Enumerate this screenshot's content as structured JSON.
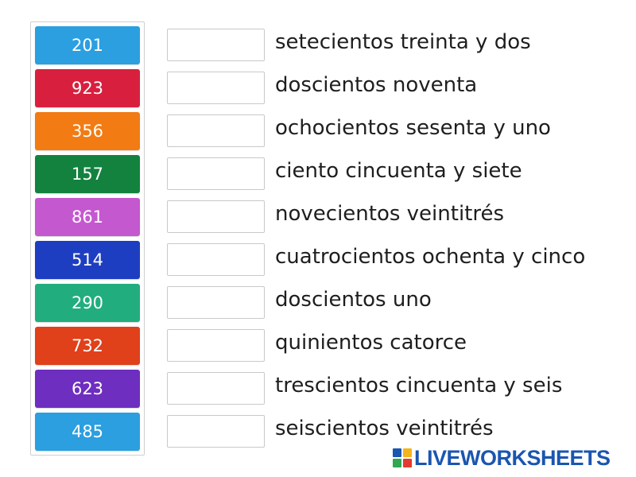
{
  "tiles": [
    {
      "label": "201",
      "color": "#2b9fe0"
    },
    {
      "label": "923",
      "color": "#d8203e"
    },
    {
      "label": "356",
      "color": "#f27b13"
    },
    {
      "label": "157",
      "color": "#12823e"
    },
    {
      "label": "861",
      "color": "#c458cf"
    },
    {
      "label": "514",
      "color": "#1e3ec2"
    },
    {
      "label": "290",
      "color": "#22ad7e"
    },
    {
      "label": "732",
      "color": "#e0401a"
    },
    {
      "label": "623",
      "color": "#6e2ebf"
    },
    {
      "label": "485",
      "color": "#2b9fe0"
    }
  ],
  "phrases": [
    "setecientos treinta y dos",
    "doscientos noventa",
    "ochocientos sesenta y uno",
    "ciento cincuenta y siete",
    "novecientos veintitrés",
    "cuatrocientos ochenta y cinco",
    "doscientos uno",
    "quinientos catorce",
    "trescientos cincuenta y seis",
    "seiscientos veintitrés"
  ],
  "answers": [
    "",
    "",
    "",
    "",
    "",
    "",
    "",
    "",
    "",
    ""
  ],
  "brand": {
    "text": "LIVEWORKSHEETS",
    "color": "#1a56b0",
    "icon": "liveworksheets-logo-icon"
  }
}
